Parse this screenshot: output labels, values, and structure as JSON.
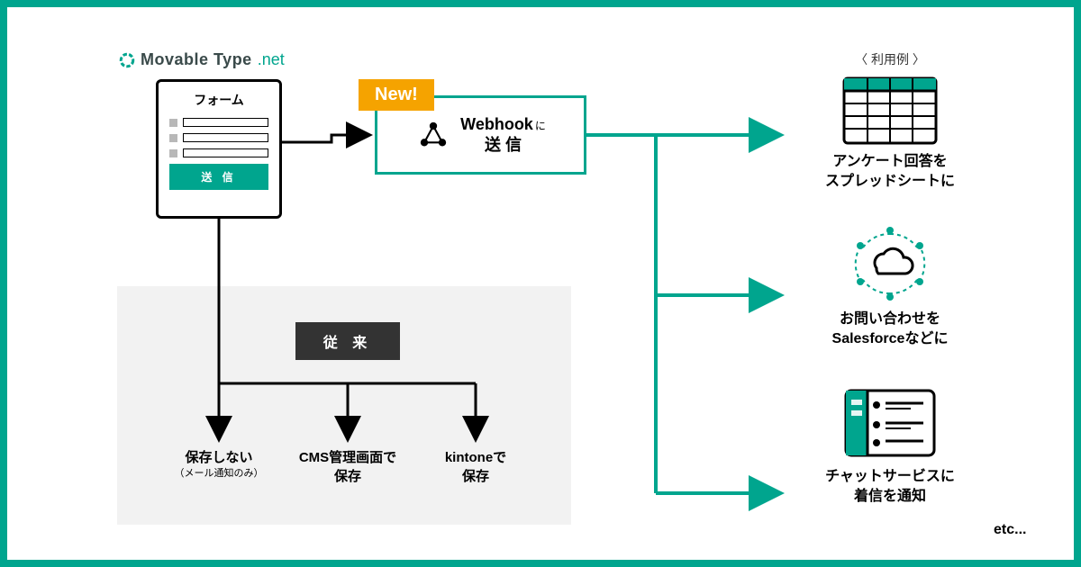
{
  "logo": {
    "brand": "Movable Type",
    "suffix": ".net"
  },
  "form": {
    "title": "フォーム",
    "submit": "送 信"
  },
  "new_badge": "New!",
  "webhook": {
    "label_main": "Webhook",
    "particle": "に",
    "action": "送 信"
  },
  "conventional": {
    "label": "従 来",
    "options": [
      {
        "title": "保存しない",
        "sub": "（メール通知のみ）"
      },
      {
        "title": "CMS管理画面で\n保存",
        "sub": ""
      },
      {
        "title": "kintoneで\n保存",
        "sub": ""
      }
    ]
  },
  "usage_header": "〈 利用例 〉",
  "usecases": [
    {
      "caption": "アンケート回答を\nスプレッドシートに"
    },
    {
      "caption": "お問い合わせを\nSalesforceなどに"
    },
    {
      "caption": "チャットサービスに\n着信を通知"
    }
  ],
  "etc": "etc..."
}
